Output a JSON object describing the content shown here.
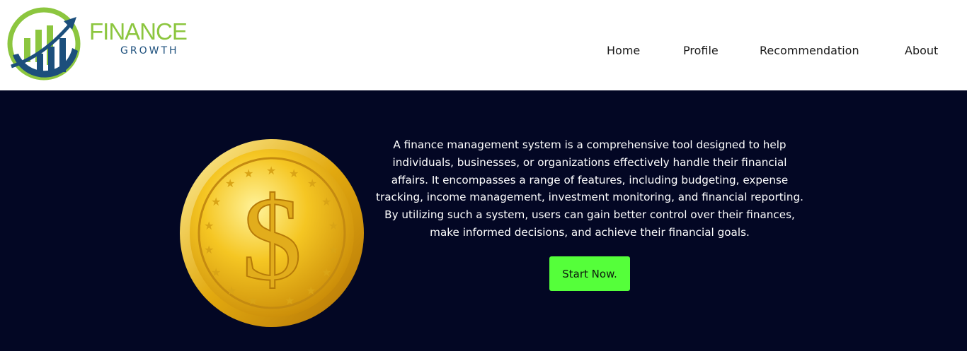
{
  "brand": {
    "name_top": "FINANCE",
    "name_bottom": "GROWTH",
    "colors": {
      "green": "#8cc63f",
      "blue": "#1c4f7c"
    }
  },
  "nav": {
    "items": [
      {
        "label": "Home"
      },
      {
        "label": "Profile"
      },
      {
        "label": "Recommendation"
      },
      {
        "label": "About"
      }
    ]
  },
  "hero": {
    "description": "A finance management system is a comprehensive tool designed to help individuals, businesses, or organizations effectively handle their financial affairs. It encompasses a range of features, including budgeting, expense tracking, income management, investment monitoring, and financial reporting. By utilizing such a system, users can gain better control over their finances, make informed decisions, and achieve their financial goals.",
    "cta_label": "Start Now.",
    "coin_icon": "gold-dollar-coin",
    "colors": {
      "background": "#030724",
      "cta": "#55ff3a"
    }
  }
}
